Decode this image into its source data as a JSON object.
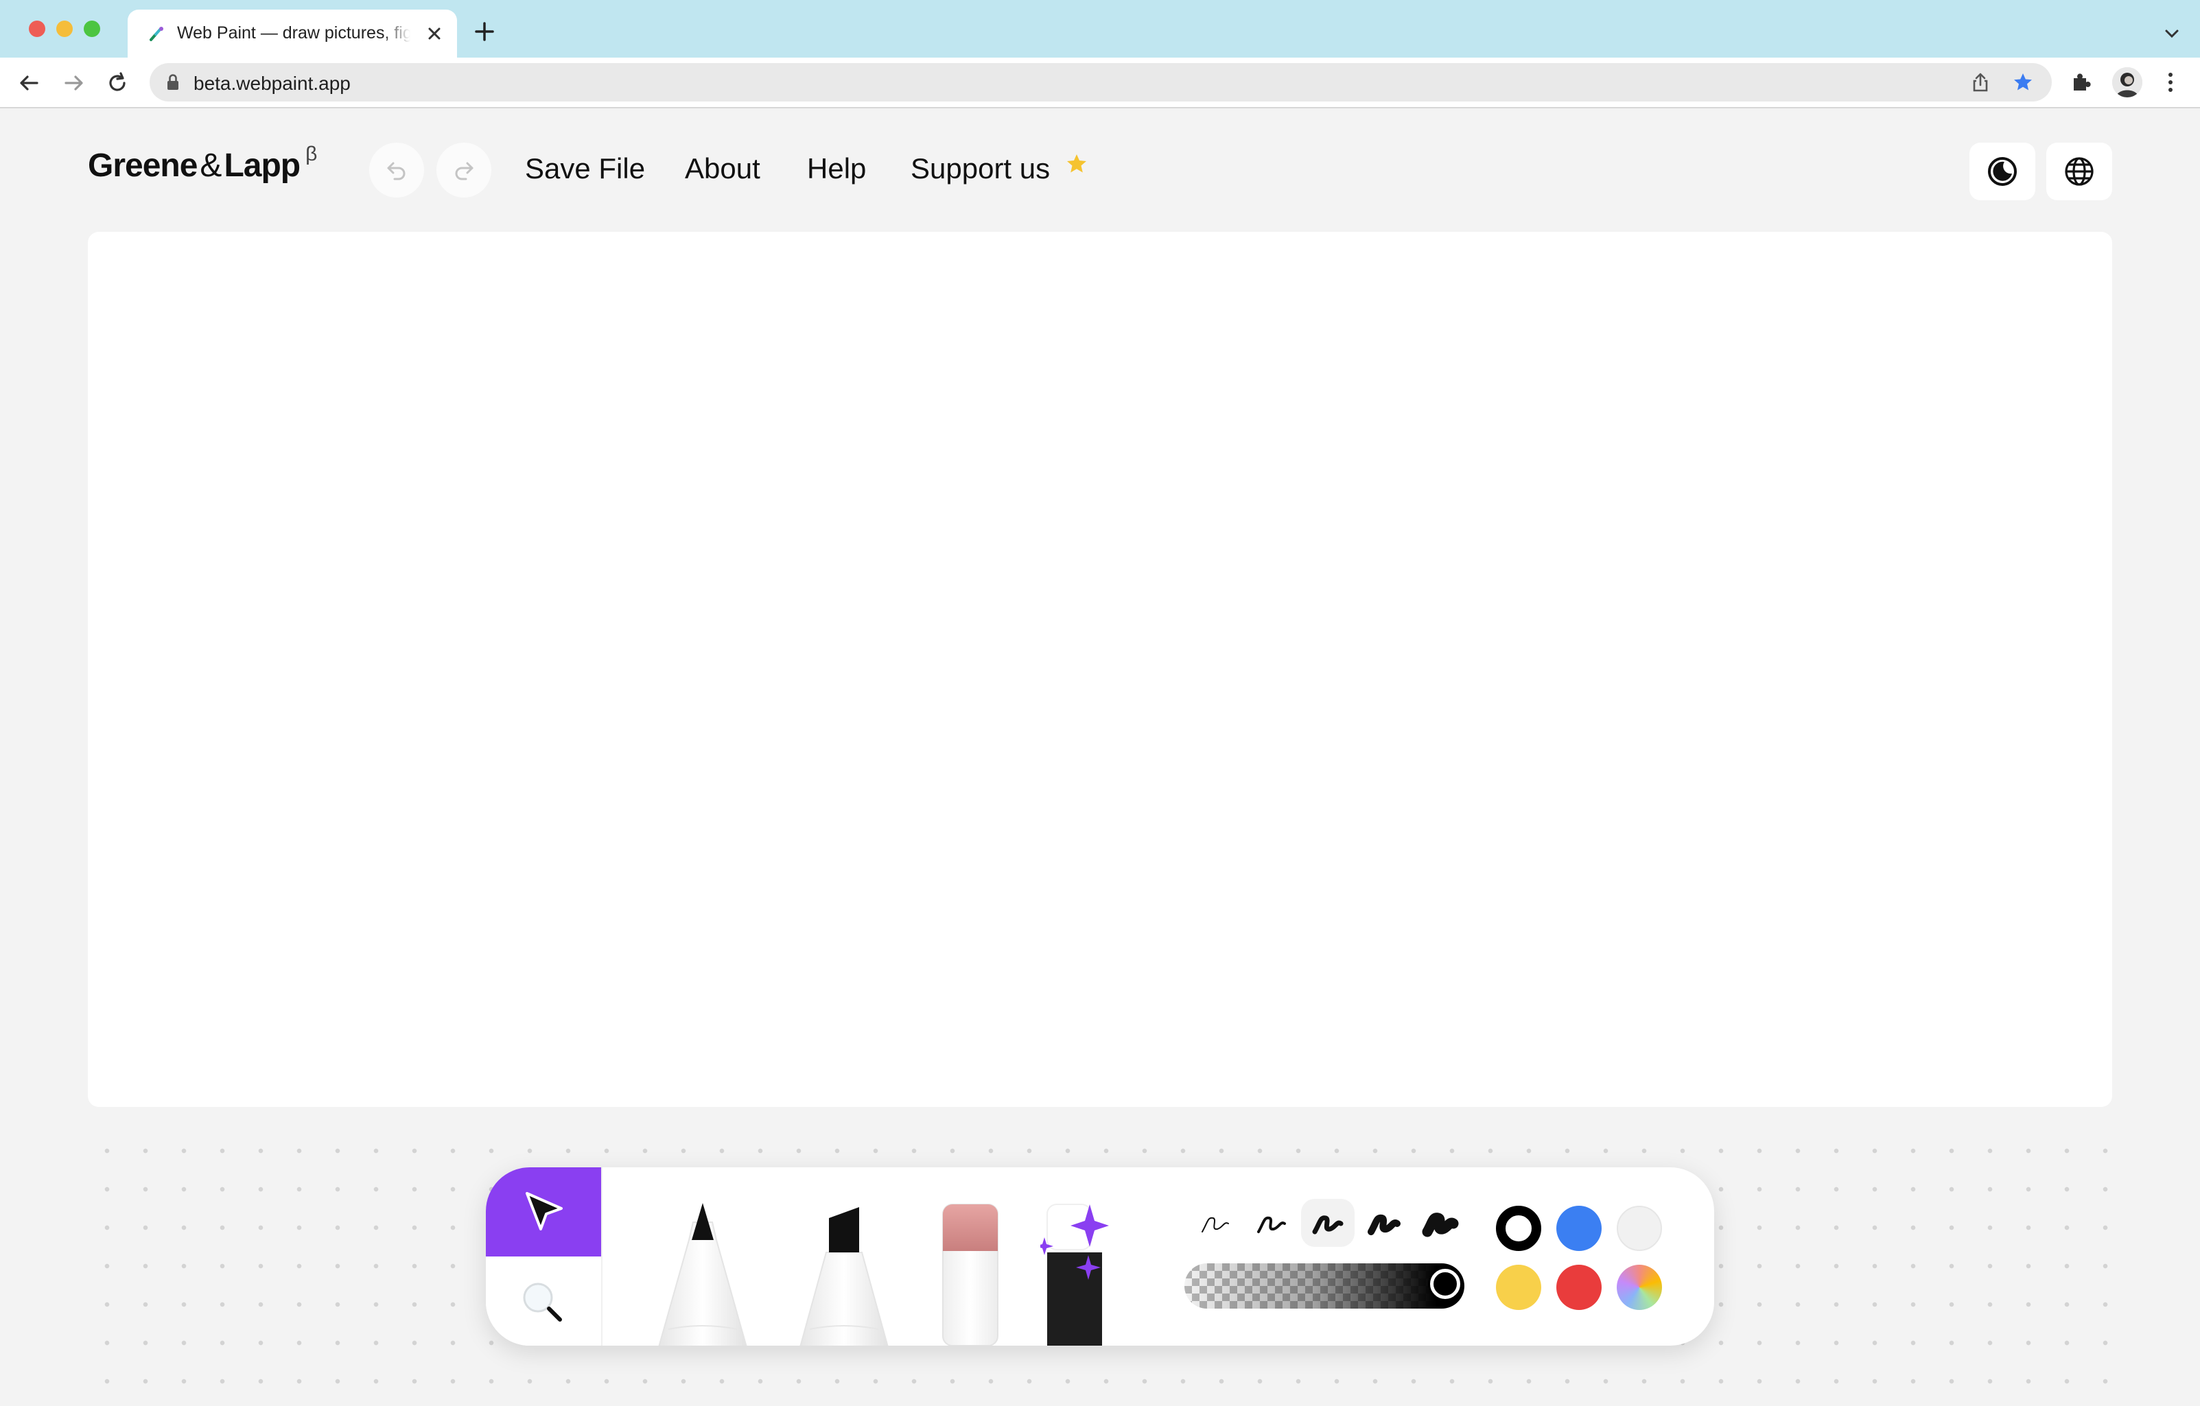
{
  "browser": {
    "tab_title": "Web Paint — draw pictures, figures",
    "url": "beta.webpaint.app",
    "new_tab_symbol": "+"
  },
  "header": {
    "logo": {
      "part1": "Greene",
      "amp": "&",
      "part2": "Lapp",
      "badge": "β"
    },
    "menu": {
      "save": "Save File",
      "about": "About",
      "help": "Help",
      "support": "Support us"
    }
  },
  "tools": [
    "select",
    "zoom",
    "pencil",
    "marker",
    "eraser",
    "magic-wand"
  ],
  "active_tool": "select",
  "brush_sizes": [
    "1",
    "2",
    "3",
    "4",
    "5"
  ],
  "selected_brush_size": "3",
  "opacity_percent": 100,
  "colors": [
    "#000000",
    "#3b82f6",
    "#f0f0f0",
    "#f8d34a",
    "#e93c3c",
    "rainbow"
  ],
  "selected_color": "#000000",
  "accent": "#8a3ff1",
  "icons": [
    "back-icon",
    "forward-icon",
    "reload-icon",
    "lock-icon",
    "share-icon",
    "bookmark-star-icon",
    "extensions-icon",
    "profile-avatar",
    "kebab-menu-icon",
    "undo-icon",
    "redo-icon",
    "star-icon",
    "moon-icon",
    "globe-icon",
    "cursor-icon",
    "magnifier-icon"
  ]
}
